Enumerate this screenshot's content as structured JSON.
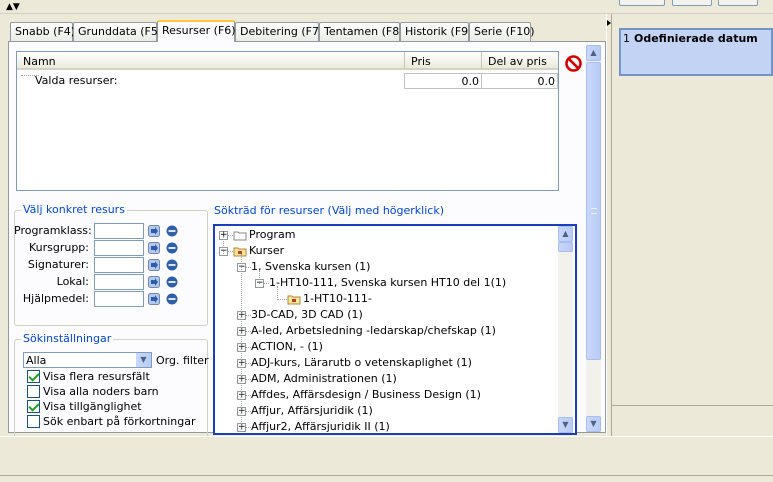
{
  "tabs": [
    {
      "label": "Snabb (F4)",
      "active": false
    },
    {
      "label": "Grunddata (F5)",
      "active": false
    },
    {
      "label": "Resurser (F6)",
      "active": true
    },
    {
      "label": "Debitering (F7)",
      "active": false
    },
    {
      "label": "Tentamen (F8)",
      "active": false
    },
    {
      "label": "Historik (F9)",
      "active": false
    },
    {
      "label": "Serie (F10)",
      "active": false
    }
  ],
  "resource_table": {
    "columns": [
      "Namn",
      "Pris",
      "Del av pris"
    ],
    "rows": [
      {
        "name": "Valda resurser:",
        "price": "0.0",
        "share": "0.0"
      }
    ]
  },
  "specific_resource": {
    "title": "Välj konkret resurs",
    "fields": [
      {
        "label": "Programklass:",
        "value": ""
      },
      {
        "label": "Kursgrupp:",
        "value": ""
      },
      {
        "label": "Signaturer:",
        "value": ""
      },
      {
        "label": "Lokal:",
        "value": ""
      },
      {
        "label": "Hjälpmedel:",
        "value": ""
      }
    ]
  },
  "search_settings": {
    "title": "Sökinställningar",
    "filter_value": "Alla",
    "filter_label": "Org. filter",
    "options": [
      {
        "label": "Visa flera resursfält",
        "checked": true
      },
      {
        "label": "Visa alla noders barn",
        "checked": false
      },
      {
        "label": "Visa tillgänglighet",
        "checked": true
      },
      {
        "label": "Sök enbart på förkortningar",
        "checked": false
      }
    ]
  },
  "search_tree": {
    "title": "Sökträd för resurser (Välj med högerklick)",
    "nodes": [
      {
        "label": "Program",
        "level": 0,
        "expanded": false,
        "icon": "folder"
      },
      {
        "label": "Kurser",
        "level": 0,
        "expanded": true,
        "icon": "folder-lock"
      },
      {
        "label": "1, Svenska kursen (1)",
        "level": 1,
        "expanded": true
      },
      {
        "label": "1-HT10-111, Svenska kursen HT10 del 1(1)",
        "level": 2,
        "expanded": true
      },
      {
        "label": "1-HT10-111-",
        "level": 3,
        "icon": "folder-lock"
      },
      {
        "label": "3D-CAD, 3D CAD (1)",
        "level": 1,
        "expanded": false
      },
      {
        "label": "A-led, Arbetsledning -ledarskap/chefskap (1)",
        "level": 1,
        "expanded": false
      },
      {
        "label": "ACTION, - (1)",
        "level": 1,
        "expanded": false
      },
      {
        "label": "ADJ-kurs, Lärarutb o vetenskaplighet (1)",
        "level": 1,
        "expanded": false
      },
      {
        "label": "ADM, Administrationen (1)",
        "level": 1,
        "expanded": false
      },
      {
        "label": "Affdes, Affärsdesign / Business Design (1)",
        "level": 1,
        "expanded": false
      },
      {
        "label": "Affjur, Affärsjuridik (1)",
        "level": 1,
        "expanded": false
      },
      {
        "label": "Affjur2, Affärsjuridik II (1)",
        "level": 1,
        "expanded": false
      }
    ]
  },
  "right_panel": {
    "number": "1",
    "title": "Odefinierade datum"
  },
  "icons": {
    "delete": "no-entry-icon",
    "browse": "arrow-icon",
    "clear": "eraser-icon"
  },
  "colors": {
    "accent": "#1d3ebc",
    "tab_highlight": "#ffc83c",
    "group_title": "#0046d5",
    "delete": "#d40000"
  }
}
